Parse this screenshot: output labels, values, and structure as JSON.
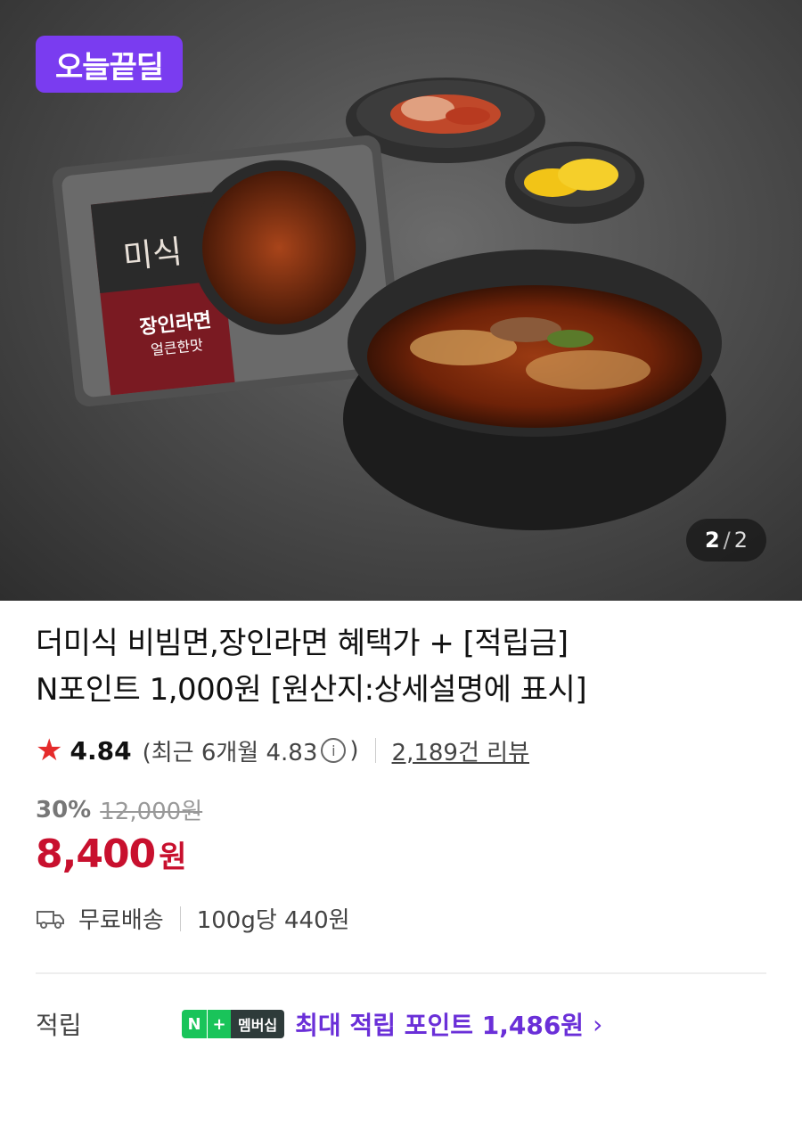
{
  "hero": {
    "badge": "오늘끝딜",
    "counter": {
      "current": "2",
      "separator": "/",
      "total": "2"
    },
    "package": {
      "brand": "미식",
      "product": "장인라면",
      "flavor": "얼큰한맛"
    }
  },
  "product": {
    "title_line1": "더미식 비빔면,장인라면 혜택가 + [적립금]",
    "title_line2": "N포인트 1,000원 [원산지:상세설명에 표시]"
  },
  "rating": {
    "score": "4.84",
    "recent_prefix": "(최근 6개월 4.83",
    "recent_suffix": ")",
    "info_icon": "i",
    "reviews": "2,189건 리뷰"
  },
  "price": {
    "discount": "30%",
    "original": "12,000원",
    "sale": "8,400",
    "unit": "원"
  },
  "shipping": {
    "free": "무료배송",
    "unit_price": "100g당 440원"
  },
  "reward": {
    "label": "적립",
    "badge_n": "N",
    "badge_plus": "+",
    "badge_membership": "멤버십",
    "text": "최대 적립 포인트 1,486원"
  },
  "colors": {
    "accent_purple": "#7a3cf0",
    "price_red": "#c8102e",
    "naver_green": "#19c45a"
  }
}
